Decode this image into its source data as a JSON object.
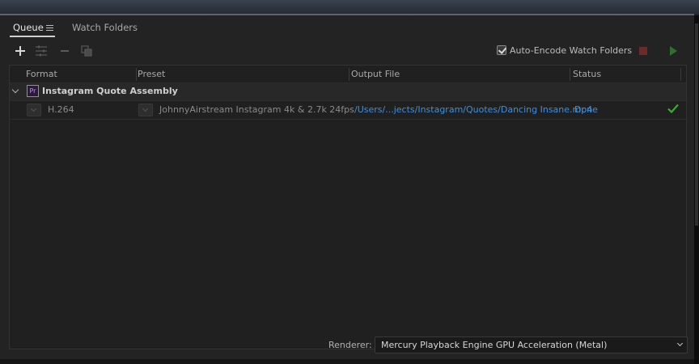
{
  "tabs": [
    {
      "label": "Queue"
    },
    {
      "label": "Watch Folders"
    }
  ],
  "toolbar": {
    "add_icon": "plus-icon",
    "settings_icon": "sliders-icon",
    "remove_icon": "minus-icon",
    "duplicate_icon": "duplicate-icon",
    "auto_encode_label": "Auto-Encode Watch Folders",
    "auto_encode_checked": true,
    "stop_icon": "stop-icon",
    "start_icon": "play-icon"
  },
  "table": {
    "columns": [
      "Format",
      "Preset",
      "Output File",
      "Status"
    ],
    "groups": [
      {
        "badge": "Pr",
        "title": "Instagram Quote Assembly",
        "items": [
          {
            "format": "H.264",
            "preset": "JohnnyAirstream Instagram 4k & 2.7k 24fps",
            "output_file": "/Users/...jects/Instagram/Quotes/Dancing Insane.mp4",
            "status": "Done"
          }
        ]
      }
    ]
  },
  "footer": {
    "renderer_label": "Renderer:",
    "renderer_value": "Mercury Playback Engine GPU Acceleration (Metal)"
  },
  "colors": {
    "accent_link": "#3d8fe0",
    "done_check": "#3ea83e",
    "stop_red": "#6e2a2a",
    "play_green": "#2f6e2f",
    "premiere_purple": "#b071e6"
  }
}
